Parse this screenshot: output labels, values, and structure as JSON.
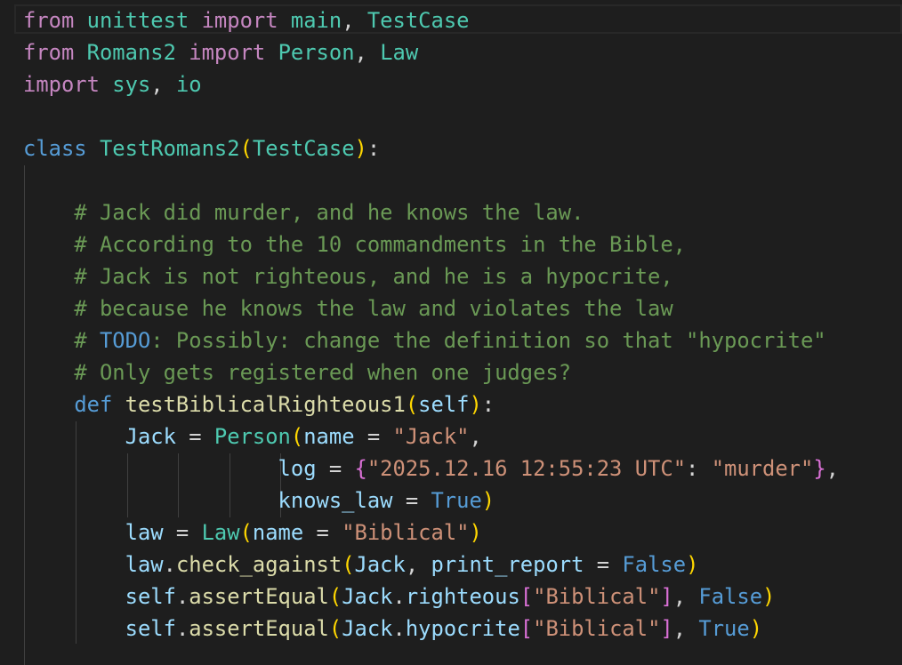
{
  "editor": {
    "theme_background": "#1e1e1e",
    "token_colors": {
      "keyword_control": "#c586c0",
      "keyword": "#569cd6",
      "type": "#4ec9b0",
      "function": "#dcdcaa",
      "variable": "#9cdcfe",
      "string": "#ce9178",
      "comment": "#6a9955",
      "bracket_level1": "#ffd700",
      "bracket_level2": "#da70d6",
      "bracket_level3": "#179fff"
    },
    "lines": [
      [
        {
          "t": "from",
          "c": "kw-purple"
        },
        {
          "t": " ",
          "c": "plain"
        },
        {
          "t": "unittest",
          "c": "type"
        },
        {
          "t": " ",
          "c": "plain"
        },
        {
          "t": "import",
          "c": "kw-purple"
        },
        {
          "t": " ",
          "c": "plain"
        },
        {
          "t": "main",
          "c": "type"
        },
        {
          "t": ", ",
          "c": "plain"
        },
        {
          "t": "TestCase",
          "c": "type"
        }
      ],
      [
        {
          "t": "from",
          "c": "kw-purple"
        },
        {
          "t": " ",
          "c": "plain"
        },
        {
          "t": "Romans2",
          "c": "type"
        },
        {
          "t": " ",
          "c": "plain"
        },
        {
          "t": "import",
          "c": "kw-purple"
        },
        {
          "t": " ",
          "c": "plain"
        },
        {
          "t": "Person",
          "c": "type"
        },
        {
          "t": ", ",
          "c": "plain"
        },
        {
          "t": "Law",
          "c": "type"
        }
      ],
      [
        {
          "t": "import",
          "c": "kw-purple"
        },
        {
          "t": " ",
          "c": "plain"
        },
        {
          "t": "sys",
          "c": "type"
        },
        {
          "t": ", ",
          "c": "plain"
        },
        {
          "t": "io",
          "c": "type"
        }
      ],
      [],
      [
        {
          "t": "class",
          "c": "kw-blue"
        },
        {
          "t": " ",
          "c": "plain"
        },
        {
          "t": "TestRomans2",
          "c": "type"
        },
        {
          "t": "(",
          "c": "b-gold"
        },
        {
          "t": "TestCase",
          "c": "type"
        },
        {
          "t": ")",
          "c": "b-gold"
        },
        {
          "t": ":",
          "c": "plain"
        }
      ],
      [],
      [
        {
          "t": "    ",
          "c": "plain"
        },
        {
          "t": "# Jack did murder, and he knows the law.",
          "c": "cmt"
        }
      ],
      [
        {
          "t": "    ",
          "c": "plain"
        },
        {
          "t": "# According to the 10 commandments in the Bible,",
          "c": "cmt"
        }
      ],
      [
        {
          "t": "    ",
          "c": "plain"
        },
        {
          "t": "# Jack is not righteous, and he is a hypocrite,",
          "c": "cmt"
        }
      ],
      [
        {
          "t": "    ",
          "c": "plain"
        },
        {
          "t": "# because he knows the law and violates the law",
          "c": "cmt"
        }
      ],
      [
        {
          "t": "    ",
          "c": "plain"
        },
        {
          "t": "# ",
          "c": "cmt"
        },
        {
          "t": "TODO",
          "c": "todo"
        },
        {
          "t": ": Possibly: change the definition so that \"hypocrite\"",
          "c": "cmt"
        }
      ],
      [
        {
          "t": "    ",
          "c": "plain"
        },
        {
          "t": "# Only gets registered when one judges?",
          "c": "cmt"
        }
      ],
      [
        {
          "t": "    ",
          "c": "plain"
        },
        {
          "t": "def",
          "c": "kw-blue"
        },
        {
          "t": " ",
          "c": "plain"
        },
        {
          "t": "testBiblicalRighteous1",
          "c": "func"
        },
        {
          "t": "(",
          "c": "b-gold"
        },
        {
          "t": "self",
          "c": "var"
        },
        {
          "t": ")",
          "c": "b-gold"
        },
        {
          "t": ":",
          "c": "plain"
        }
      ],
      [
        {
          "t": "        ",
          "c": "plain"
        },
        {
          "t": "Jack",
          "c": "var"
        },
        {
          "t": " = ",
          "c": "plain"
        },
        {
          "t": "Person",
          "c": "type"
        },
        {
          "t": "(",
          "c": "b-gold"
        },
        {
          "t": "name",
          "c": "var"
        },
        {
          "t": " = ",
          "c": "plain"
        },
        {
          "t": "\"Jack\"",
          "c": "str"
        },
        {
          "t": ",",
          "c": "plain"
        }
      ],
      [
        {
          "t": "                    ",
          "c": "plain"
        },
        {
          "t": "log",
          "c": "var"
        },
        {
          "t": " = ",
          "c": "plain"
        },
        {
          "t": "{",
          "c": "b-pink"
        },
        {
          "t": "\"2025.12.16 12:55:23 UTC\"",
          "c": "str"
        },
        {
          "t": ": ",
          "c": "plain"
        },
        {
          "t": "\"murder\"",
          "c": "str"
        },
        {
          "t": "}",
          "c": "b-pink"
        },
        {
          "t": ",",
          "c": "plain"
        }
      ],
      [
        {
          "t": "                    ",
          "c": "plain"
        },
        {
          "t": "knows_law",
          "c": "var"
        },
        {
          "t": " = ",
          "c": "plain"
        },
        {
          "t": "True",
          "c": "kw-blue"
        },
        {
          "t": ")",
          "c": "b-gold"
        }
      ],
      [
        {
          "t": "        ",
          "c": "plain"
        },
        {
          "t": "law",
          "c": "var"
        },
        {
          "t": " = ",
          "c": "plain"
        },
        {
          "t": "Law",
          "c": "type"
        },
        {
          "t": "(",
          "c": "b-gold"
        },
        {
          "t": "name",
          "c": "var"
        },
        {
          "t": " = ",
          "c": "plain"
        },
        {
          "t": "\"Biblical\"",
          "c": "str"
        },
        {
          "t": ")",
          "c": "b-gold"
        }
      ],
      [
        {
          "t": "        ",
          "c": "plain"
        },
        {
          "t": "law",
          "c": "var"
        },
        {
          "t": ".",
          "c": "plain"
        },
        {
          "t": "check_against",
          "c": "func"
        },
        {
          "t": "(",
          "c": "b-gold"
        },
        {
          "t": "Jack",
          "c": "var"
        },
        {
          "t": ", ",
          "c": "plain"
        },
        {
          "t": "print_report",
          "c": "var"
        },
        {
          "t": " = ",
          "c": "plain"
        },
        {
          "t": "False",
          "c": "kw-blue"
        },
        {
          "t": ")",
          "c": "b-gold"
        }
      ],
      [
        {
          "t": "        ",
          "c": "plain"
        },
        {
          "t": "self",
          "c": "var"
        },
        {
          "t": ".",
          "c": "plain"
        },
        {
          "t": "assertEqual",
          "c": "func"
        },
        {
          "t": "(",
          "c": "b-gold"
        },
        {
          "t": "Jack",
          "c": "var"
        },
        {
          "t": ".",
          "c": "plain"
        },
        {
          "t": "righteous",
          "c": "var"
        },
        {
          "t": "[",
          "c": "b-pink"
        },
        {
          "t": "\"Biblical\"",
          "c": "str"
        },
        {
          "t": "]",
          "c": "b-pink"
        },
        {
          "t": ", ",
          "c": "plain"
        },
        {
          "t": "False",
          "c": "kw-blue"
        },
        {
          "t": ")",
          "c": "b-gold"
        }
      ],
      [
        {
          "t": "        ",
          "c": "plain"
        },
        {
          "t": "self",
          "c": "var"
        },
        {
          "t": ".",
          "c": "plain"
        },
        {
          "t": "assertEqual",
          "c": "func"
        },
        {
          "t": "(",
          "c": "b-gold"
        },
        {
          "t": "Jack",
          "c": "var"
        },
        {
          "t": ".",
          "c": "plain"
        },
        {
          "t": "hypocrite",
          "c": "var"
        },
        {
          "t": "[",
          "c": "b-pink"
        },
        {
          "t": "\"Biblical\"",
          "c": "str"
        },
        {
          "t": "]",
          "c": "b-pink"
        },
        {
          "t": ", ",
          "c": "plain"
        },
        {
          "t": "True",
          "c": "kw-blue"
        },
        {
          "t": ")",
          "c": "b-gold"
        }
      ]
    ]
  }
}
